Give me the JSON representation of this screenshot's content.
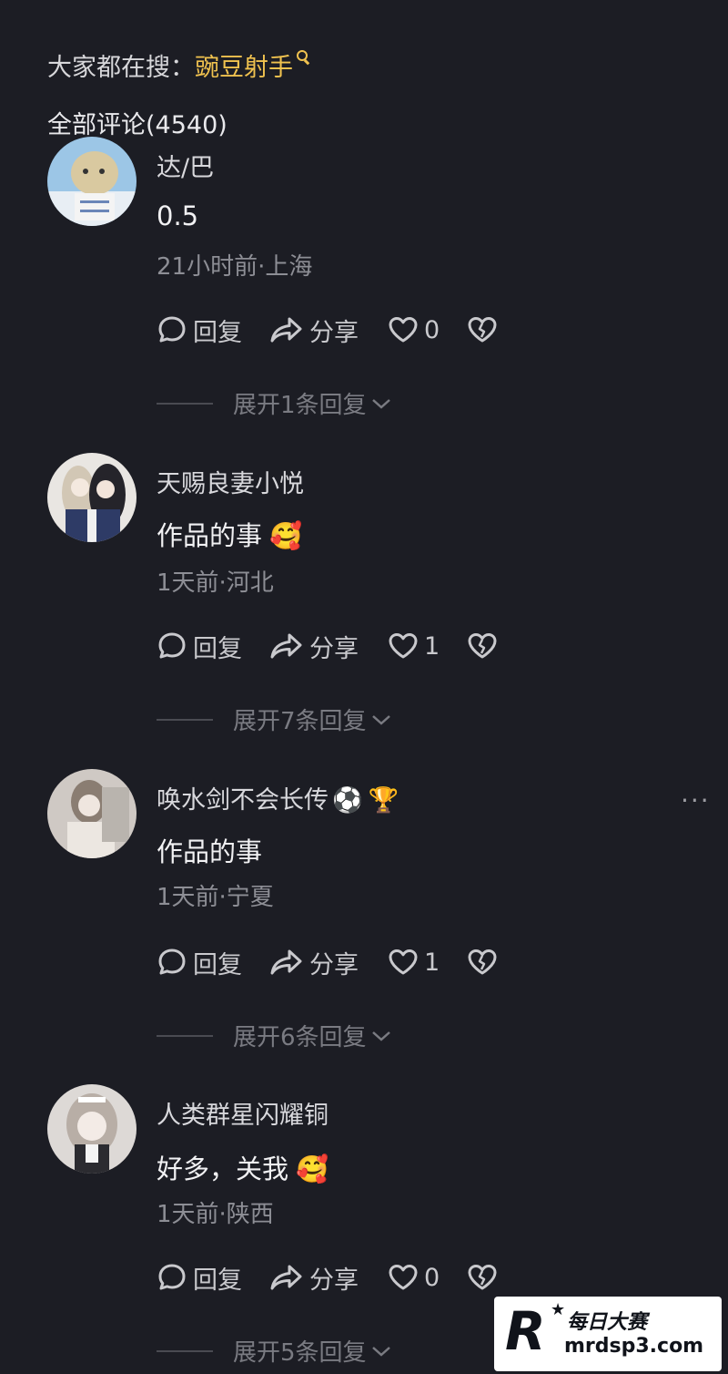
{
  "search": {
    "prefix": "大家都在搜：",
    "term": "豌豆射手"
  },
  "comments_header": "全部评论(4540)",
  "comments": [
    {
      "username": "达/巴",
      "text": "0.5",
      "emoji": "",
      "meta": "21小时前·上海",
      "reply_label": "回复",
      "share_label": "分享",
      "likes": "0",
      "expand": "展开1条回复"
    },
    {
      "username": "天赐良妻小悦",
      "text": "作品的事",
      "emoji": "🥰",
      "meta": "1天前·河北",
      "reply_label": "回复",
      "share_label": "分享",
      "likes": "1",
      "expand": "展开7条回复"
    },
    {
      "username": "唤水剑不会长传",
      "text": "作品的事",
      "emoji": "",
      "meta": "1天前·宁夏",
      "reply_label": "回复",
      "share_label": "分享",
      "likes": "1",
      "expand": "展开6条回复",
      "more": "···"
    },
    {
      "username": "人类群星闪耀铜",
      "text": "好多，关我",
      "emoji": "🥰",
      "meta": "1天前·陕西",
      "reply_label": "回复",
      "share_label": "分享",
      "likes": "0",
      "expand": "展开5条回复"
    }
  ],
  "watermark": {
    "brand": "每日大赛",
    "url": "mrdsp3.com",
    "logo_letter": "R"
  },
  "colors": {
    "background": "#1c1d24",
    "highlight": "#f0c24f",
    "muted": "#8d8e95"
  }
}
